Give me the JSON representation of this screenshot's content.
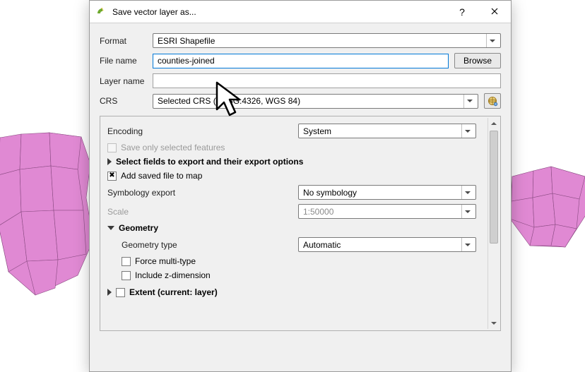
{
  "dialog": {
    "title": "Save vector layer as..."
  },
  "form": {
    "format_label": "Format",
    "format_value": "ESRI Shapefile",
    "file_name_label": "File name",
    "file_name_value": "counties-joined",
    "browse_label": "Browse",
    "layer_name_label": "Layer name",
    "layer_name_value": "",
    "crs_label": "CRS",
    "crs_value": "Selected CRS (EPSG:4326, WGS 84)"
  },
  "panel": {
    "encoding_label": "Encoding",
    "encoding_value": "System",
    "save_selected_label": "Save only selected features",
    "select_fields_label": "Select fields to export and their export options",
    "add_to_map_label": "Add saved file to map",
    "symbology_label": "Symbology export",
    "symbology_value": "No symbology",
    "scale_label": "Scale",
    "scale_value": "1:50000",
    "geometry_header": "Geometry",
    "geometry_type_label": "Geometry type",
    "geometry_type_value": "Automatic",
    "force_multi_label": "Force multi-type",
    "include_z_label": "Include z-dimension",
    "extent_label": "Extent (current: layer)"
  },
  "icons": {
    "crs_select": "crs-select-icon"
  }
}
